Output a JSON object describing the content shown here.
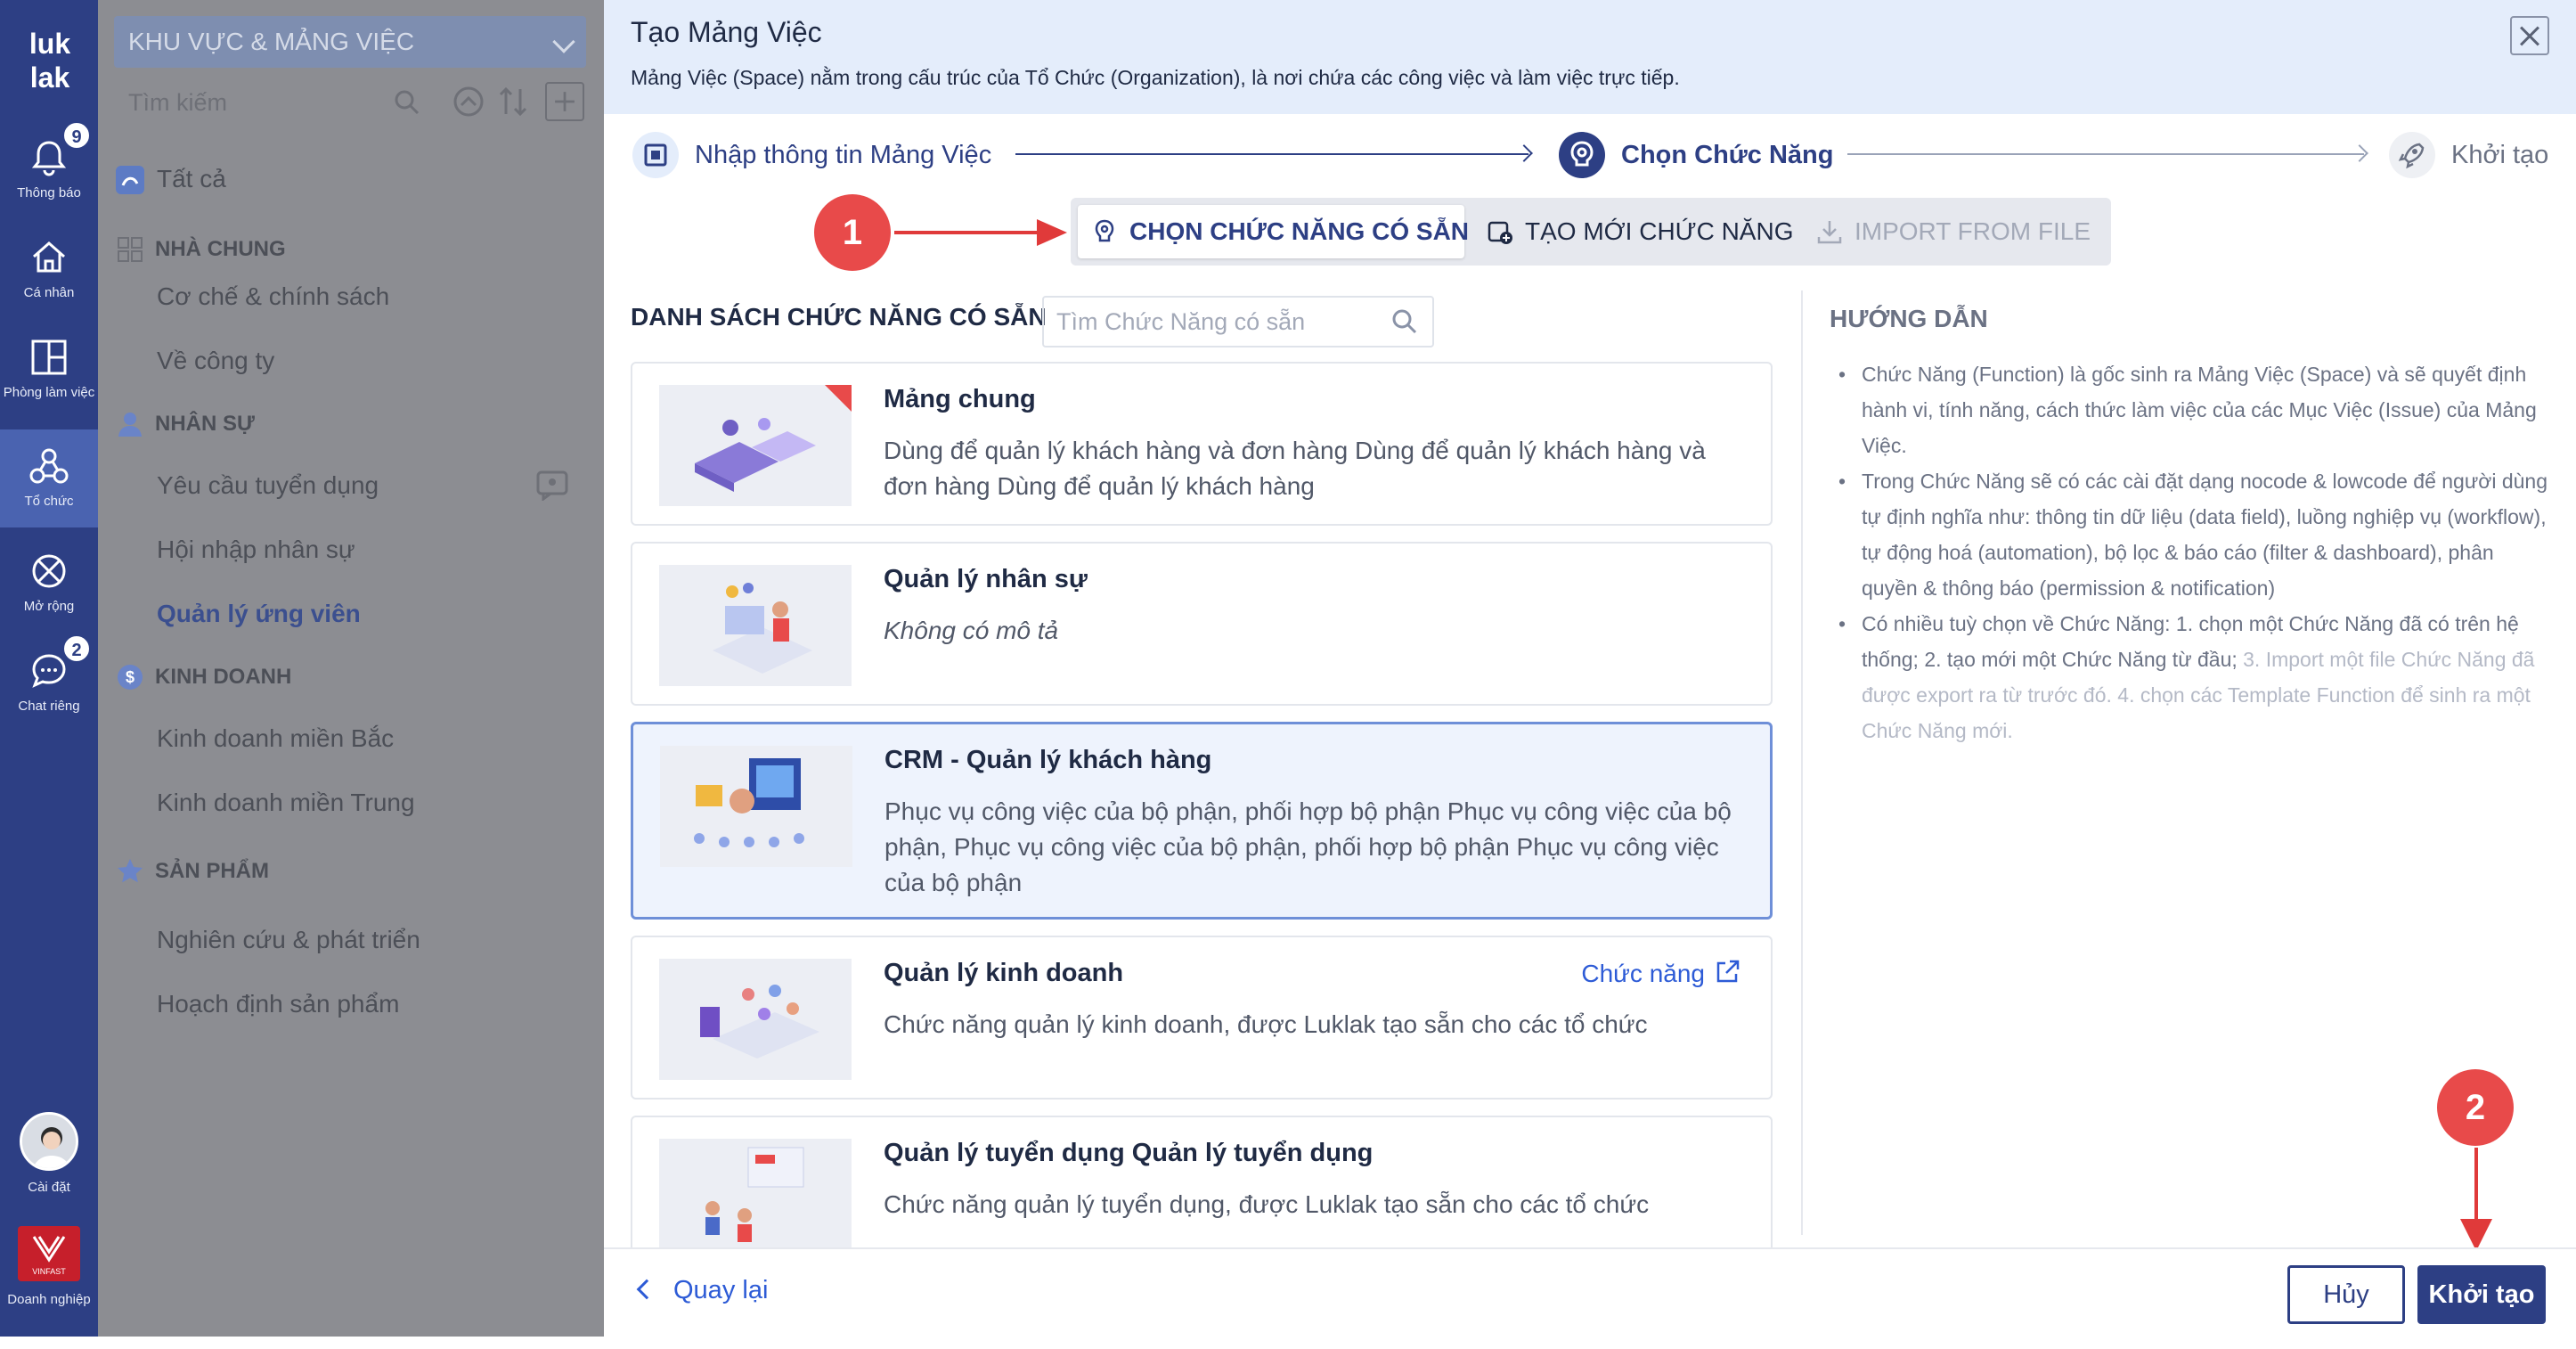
{
  "colors": {
    "rail": "#2d3f84",
    "accent": "#2d3f84",
    "link": "#2d5bd6",
    "marker": "#e84a4a",
    "header_bg": "#e4edfb"
  },
  "rail": {
    "logo": "luk lak",
    "items": [
      {
        "label": "Thông báo",
        "icon": "bell-icon",
        "badge": "9"
      },
      {
        "label": "Cá nhân",
        "icon": "home-icon"
      },
      {
        "label": "Phòng làm việc",
        "icon": "layout-icon"
      },
      {
        "label": "Tổ chức",
        "icon": "organization-icon"
      },
      {
        "label": "Mở rộng",
        "icon": "extension-icon"
      },
      {
        "label": "Chat riêng",
        "icon": "chat-icon",
        "badge": "2"
      }
    ],
    "settings_label": "Cài đặt",
    "enterprise_label": "Doanh nghiệp",
    "brand_text": "VINFAST"
  },
  "sidebar": {
    "header": "KHU VỰC & MẢNG VIỆC",
    "search_placeholder": "Tìm kiếm",
    "all_label": "Tất cả",
    "sections": [
      {
        "title": "NHÀ CHUNG",
        "icon": "grid-icon",
        "items": [
          "Cơ chế & chính sách",
          "Về công ty"
        ]
      },
      {
        "title": "NHÂN SỰ",
        "icon": "person-icon",
        "items": [
          "Yêu cầu tuyển dụng",
          "Hội nhập nhân sự",
          "Quản lý ứng viên"
        ]
      },
      {
        "title": "KINH DOANH",
        "icon": "dollar-icon",
        "items": [
          "Kinh doanh miền Bắc",
          "Kinh doanh miền Trung"
        ]
      },
      {
        "title": "SẢN PHẨM",
        "icon": "star-icon",
        "items": [
          "Nghiên cứu & phát triển",
          "Hoạch định sản phẩm"
        ]
      }
    ]
  },
  "modal": {
    "title": "Tạo Mảng Việc",
    "subtitle": "Mảng Việc (Space) nằm trong cấu trúc của Tổ Chức (Organization), là nơi chứa các công việc và làm việc trực tiếp.",
    "steps": [
      "Nhập thông tin Mảng Việc",
      "Chọn Chức Năng",
      "Khởi tạo"
    ],
    "tabs": [
      "CHỌN CHỨC NĂNG CÓ SẴN",
      "TẠO MỚI CHỨC NĂNG",
      "IMPORT FROM FILE"
    ],
    "markers": [
      "1",
      "2"
    ],
    "list_title": "DANH SÁCH CHỨC NĂNG CÓ SẴN",
    "list_search_placeholder": "Tìm Chức Năng có sẵn",
    "cards": [
      {
        "name": "Mảng chung",
        "desc": "Dùng để quản lý khách hàng và đơn hàng Dùng để quản lý khách hàng và đơn hàng Dùng để quản lý khách hàng"
      },
      {
        "name": "Quản lý nhân sự",
        "desc": "Không có mô tả"
      },
      {
        "name": "CRM - Quản lý khách hàng",
        "desc": "Phục vụ công việc của bộ phận, phối hợp bộ phận Phục vụ công việc của bộ phận, Phục vụ công việc của bộ phận, phối hợp bộ phận Phục vụ công việc của bộ phận"
      },
      {
        "name": "Quản lý kinh doanh",
        "desc": "Chức năng quản lý kinh doanh, được Luklak tạo sẵn cho các tổ chức",
        "link": "Chức năng"
      },
      {
        "name": "Quản lý tuyển dụng Quản lý tuyển dụng",
        "desc": "Chức năng quản lý tuyển dụng, được Luklak tạo sẵn cho các tổ chức"
      }
    ],
    "guide": {
      "title": "HƯỚNG DẪN",
      "items": [
        "Chức Năng (Function) là gốc sinh ra Mảng Việc (Space) và sẽ quyết định hành vi, tính năng, cách thức làm việc của các Mục Việc (Issue) của Mảng Việc.",
        "Trong Chức Năng sẽ có các cài đặt dạng nocode & lowcode để người dùng tự định nghĩa như: thông tin dữ liệu (data field), luồng nghiệp vụ (workflow), tự động hoá (automation), bộ lọc & báo cáo (filter & dashboard), phân quyền & thông báo (permission & notification)"
      ],
      "item3_main": "Có nhiều tuỳ chọn về Chức Năng: 1. chọn một Chức Năng đã có trên hệ thống; 2. tạo mới một Chức Năng từ đầu;",
      "item3_muted": "3. Import một file Chức Năng đã được export ra từ trước đó. 4. chọn các Template Function để sinh ra một Chức Năng mới."
    },
    "footer": {
      "back": "Quay lại",
      "cancel": "Hủy",
      "create": "Khởi tạo"
    }
  }
}
